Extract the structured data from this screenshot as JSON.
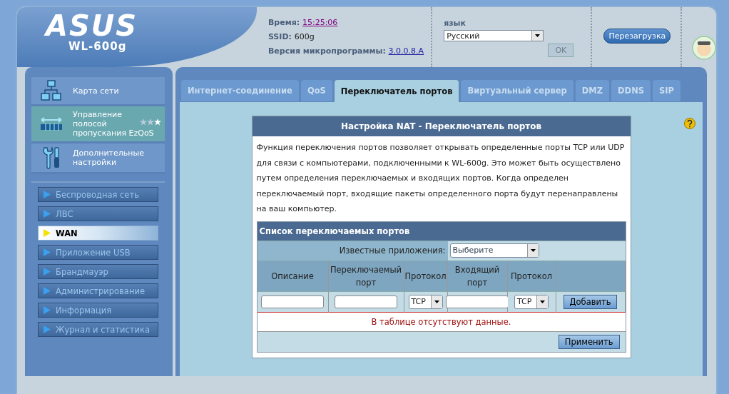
{
  "header": {
    "logo": "ASUS",
    "model": "WL-600g",
    "time_label": "Время:",
    "time": "15:25:06",
    "ssid_label": "SSID:",
    "ssid": "600g",
    "firmware_label": "Версия микропрограммы:",
    "firmware": "3.0.0.8.A",
    "language_label": "язык",
    "language": "Русский",
    "ok_button": {
      "label": "OK",
      "disabled": true
    },
    "reboot_button": "Перезагрузка"
  },
  "sidebar": {
    "main_items": [
      {
        "label": "Карта сети",
        "kind": "network",
        "selected": false
      },
      {
        "label": "Управление полосой пропускания EzQoS",
        "kind": "qos",
        "selected": true
      },
      {
        "label": "Дополнительные настройки",
        "kind": "tools",
        "selected": false
      }
    ],
    "sub_items": [
      {
        "label": "Беспроводная сеть",
        "selected": false
      },
      {
        "label": "ЛВС",
        "selected": false
      },
      {
        "label": "WAN",
        "selected": true
      },
      {
        "label": "Приложение USB",
        "selected": false
      },
      {
        "label": "Брандмауэр",
        "selected": false
      },
      {
        "label": "Администрирование",
        "selected": false
      },
      {
        "label": "Информация",
        "selected": false
      },
      {
        "label": "Журнал и статистика",
        "selected": false
      }
    ]
  },
  "tabs": [
    {
      "label": "Интернет-соединение",
      "selected": false
    },
    {
      "label": "QoS",
      "selected": false
    },
    {
      "label": "Переключатель портов",
      "selected": true
    },
    {
      "label": "Виртуальный сервер",
      "selected": false
    },
    {
      "label": "DMZ",
      "selected": false
    },
    {
      "label": "DDNS",
      "selected": false
    },
    {
      "label": "SIP",
      "selected": false
    }
  ],
  "panel": {
    "title": "Настройка NAT - Переключатель портов",
    "description": "Функция переключения портов позволяет открывать определенные порты TCP или UDP для связи с компьютерами, подключенными к WL-600g. Это может быть осуществлено путем определения переключаемых и входящих портов. Когда определен переключаемый порт, входящие пакеты определенного порта будут перенаправлены на ваш компьютер.",
    "list_title": "Список переключаемых портов",
    "known_apps_label": "Известные приложения:",
    "known_apps_value": "Выберите",
    "columns": [
      "Описание",
      "Переключаемый порт",
      "Протокол",
      "Входящий порт",
      "Протокол"
    ],
    "entry": [
      {
        "kind": "input"
      },
      {
        "kind": "input"
      },
      {
        "kind": "select",
        "value": "TCP"
      },
      {
        "kind": "input"
      },
      {
        "kind": "select",
        "value": "TCP"
      },
      {
        "kind": "button",
        "label": "Добавить"
      }
    ],
    "empty_message": "В таблице отсутствуют данные.",
    "apply_button": "Применить"
  }
}
